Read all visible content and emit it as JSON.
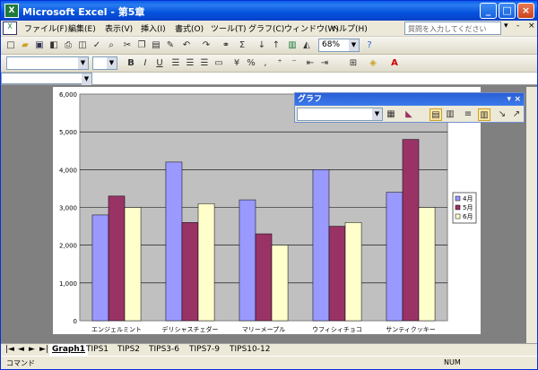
{
  "window": {
    "title": "Microsoft Excel - 第5章",
    "icon_text": "X"
  },
  "menu": {
    "items": [
      "ファイル(F)",
      "編集(E)",
      "表示(V)",
      "挿入(I)",
      "書式(O)",
      "ツール(T)",
      "グラフ(C)",
      "ウィンドウ(W)",
      "ヘルプ(H)"
    ],
    "question_placeholder": "質問を入力してください",
    "doc_icon": "X",
    "window_controls": [
      "-",
      "×"
    ]
  },
  "toolbar": {
    "zoom": "68%"
  },
  "chart_panel": {
    "title": "グラフ"
  },
  "chart_data": {
    "type": "bar",
    "categories": [
      "エンジェルミント",
      "デリシャスチェダー",
      "マリーメープル",
      "ウフィシィチョコ",
      "サンティクッキー"
    ],
    "series": [
      {
        "name": "4月",
        "values": [
          2800,
          4200,
          3200,
          4000,
          3400
        ],
        "color": "#9999ff"
      },
      {
        "name": "5月",
        "values": [
          3300,
          2600,
          2300,
          2500,
          4800
        ],
        "color": "#993366"
      },
      {
        "name": "6月",
        "values": [
          3000,
          3100,
          2000,
          2600,
          3000
        ],
        "color": "#ffffcc"
      }
    ],
    "ylim": [
      0,
      6000
    ],
    "yticks": [
      "0",
      "1,000",
      "2,000",
      "3,000",
      "4,000",
      "5,000",
      "6,000"
    ],
    "grid": true,
    "legend": "right"
  },
  "sheet_tabs": [
    "Graph1",
    "TIPS1",
    "TIPS2",
    "TIPS3-6",
    "TIPS7-9",
    "TIPS10-12"
  ],
  "nav_arrows": [
    "|◄",
    "◄",
    "►",
    "►|"
  ],
  "status": {
    "left": "コマンド",
    "right": "NUM"
  },
  "colors": {
    "plot_bg": "#c0c0c0",
    "title_bar": "#0a5fe8"
  }
}
